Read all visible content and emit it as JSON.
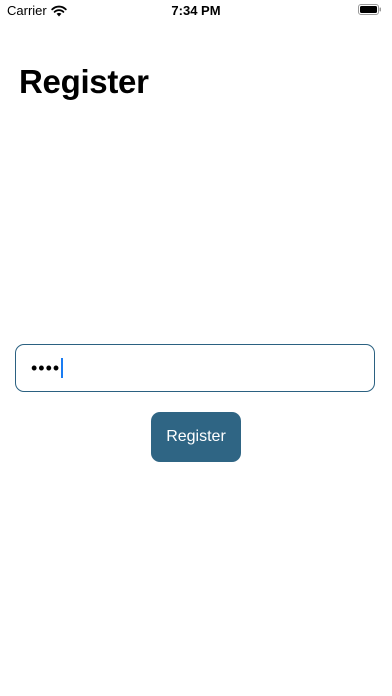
{
  "status_bar": {
    "carrier": "Carrier",
    "time": "7:34 PM"
  },
  "page": {
    "title": "Register"
  },
  "form": {
    "password_mask": "••••"
  },
  "actions": {
    "register_label": "Register"
  },
  "colors": {
    "accent": "#2f6584",
    "border": "#2b6181",
    "caret": "#1a7cf2"
  },
  "icons": [
    "wifi-icon",
    "battery-icon"
  ]
}
